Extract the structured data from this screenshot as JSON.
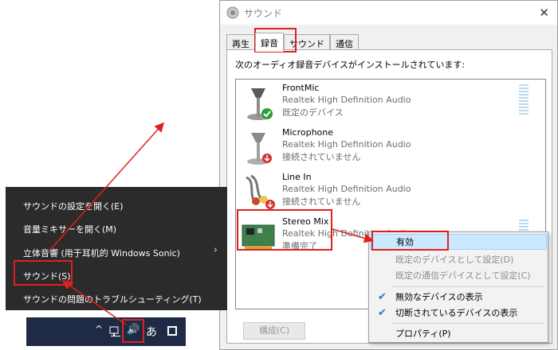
{
  "dialog": {
    "title": "サウンド",
    "close_glyph": "✕",
    "tabs": [
      "再生",
      "録音",
      "サウンド",
      "通信"
    ],
    "heading": "次のオーディオ録音デバイスがインストールされています:",
    "devices": [
      {
        "name": "FrontMic",
        "driver": "Realtek High Definition Audio",
        "status": "既定のデバイス",
        "badge": "green-check"
      },
      {
        "name": "Microphone",
        "driver": "Realtek High Definition Audio",
        "status": "接続されていません",
        "badge": "red-down-arrow"
      },
      {
        "name": "Line In",
        "driver": "Realtek High Definition Audio",
        "status": "接続されていません",
        "badge": "red-down-arrow"
      },
      {
        "name": "Stereo Mix",
        "driver": "Realtek High Definition Audio",
        "status": "準備完了",
        "badge": "none"
      }
    ],
    "configure_button": "構成(C)"
  },
  "context_menu": {
    "items": [
      {
        "label": "有効",
        "state": "highlighted"
      },
      {
        "label": "既定のデバイスとして設定(D)",
        "state": "disabled"
      },
      {
        "label": "既定の通信デバイスとして設定(C)",
        "state": "disabled"
      },
      {
        "label": "無効なデバイスの表示",
        "state": "checked"
      },
      {
        "label": "切断されているデバイスの表示",
        "state": "checked"
      },
      {
        "label": "プロパティ(P)",
        "state": "normal"
      }
    ],
    "check_glyph": "✔"
  },
  "taskbar_menu": {
    "items": [
      "サウンドの設定を開く(E)",
      "音量ミキサーを開く(M)",
      "立体音響 (用于耳机的 Windows Sonic)",
      "サウンド(S)",
      "サウンドの問題のトラブルシューティング(T)"
    ],
    "submenu_arrow": "›"
  },
  "taskbar": {
    "chevron": "^",
    "volume_glyph": "🔊",
    "ime_glyph": "あ"
  },
  "colors": {
    "annotation_red": "#e02020",
    "menu_bg": "#2b2b2b",
    "taskbar_bg": "#1f2a44",
    "highlight": "#cce8ff"
  }
}
